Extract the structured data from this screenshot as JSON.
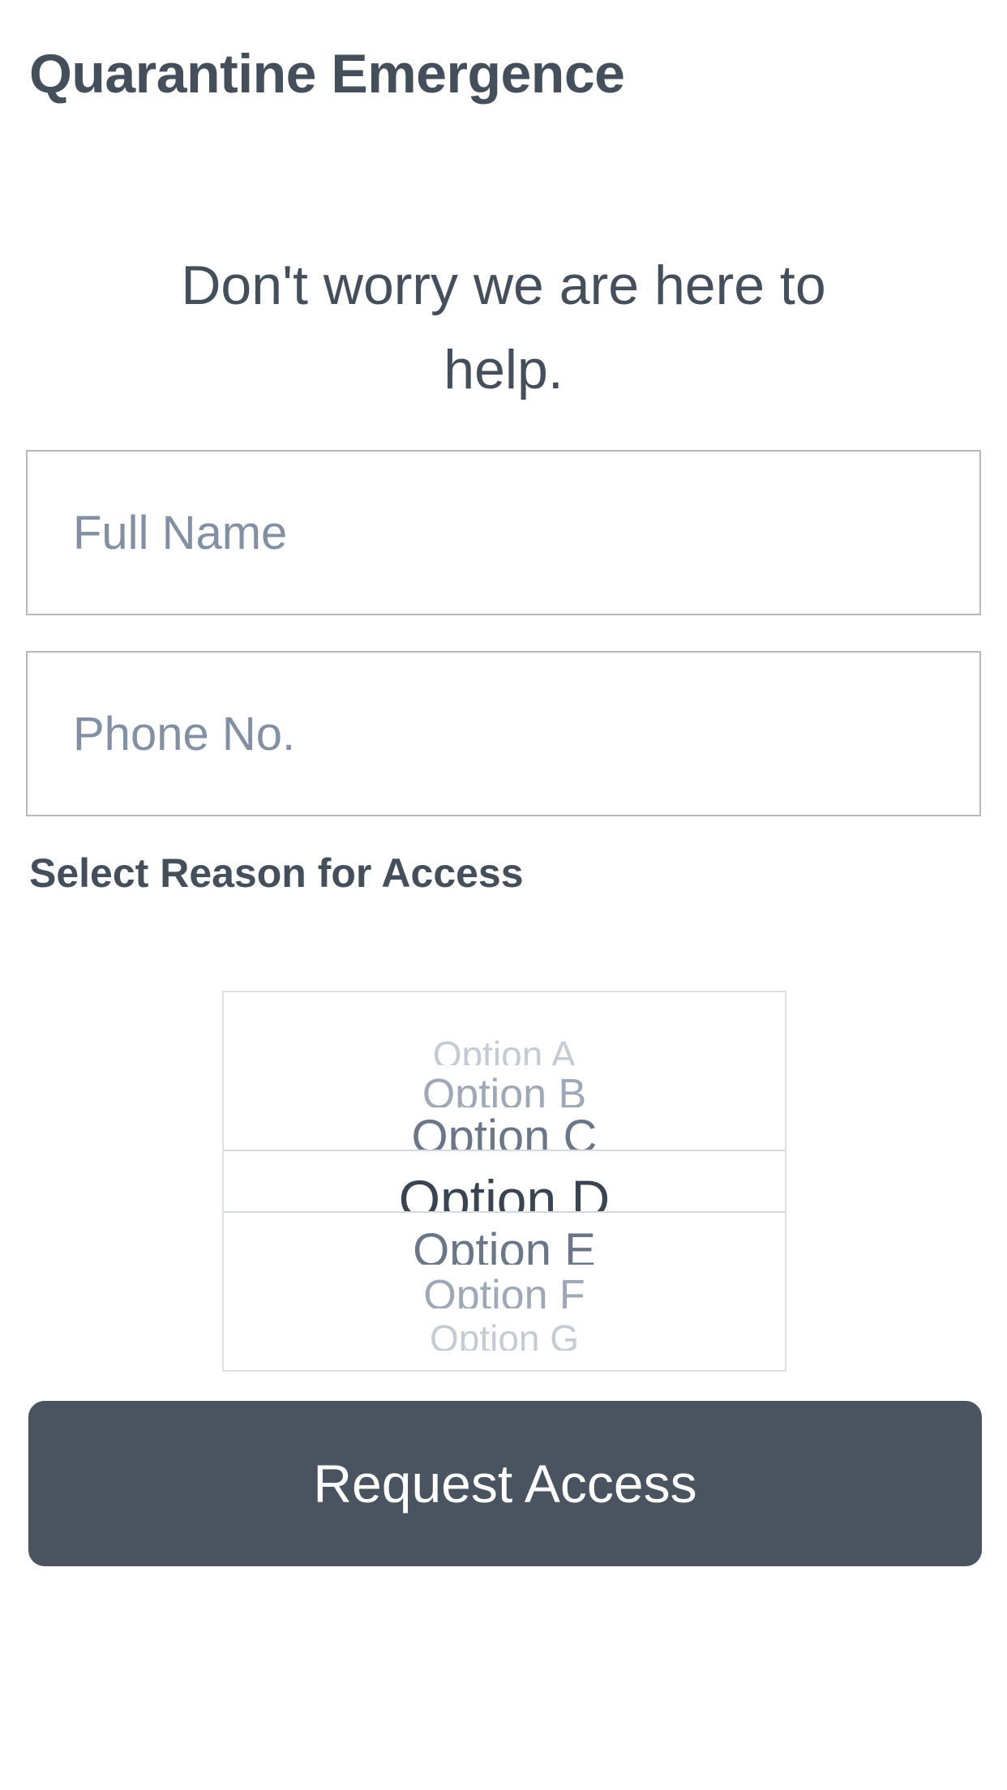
{
  "header": {
    "title": "Quarantine Emergence"
  },
  "intro": {
    "message": "Don't worry we are here to help."
  },
  "form": {
    "full_name": {
      "placeholder": "Full Name",
      "value": ""
    },
    "phone": {
      "placeholder": "Phone No.",
      "value": ""
    },
    "reason_label": "Select Reason for Access",
    "reason_picker": {
      "options": [
        "Option A",
        "Option B",
        "Option C",
        "Option D",
        "Option E",
        "Option F",
        "Option G"
      ],
      "selected": "Option D"
    },
    "submit_label": "Request Access"
  },
  "colors": {
    "text": "#454f5b",
    "placeholder": "#8390a3",
    "button_background": "#4a5360",
    "button_text": "#ffffff"
  }
}
